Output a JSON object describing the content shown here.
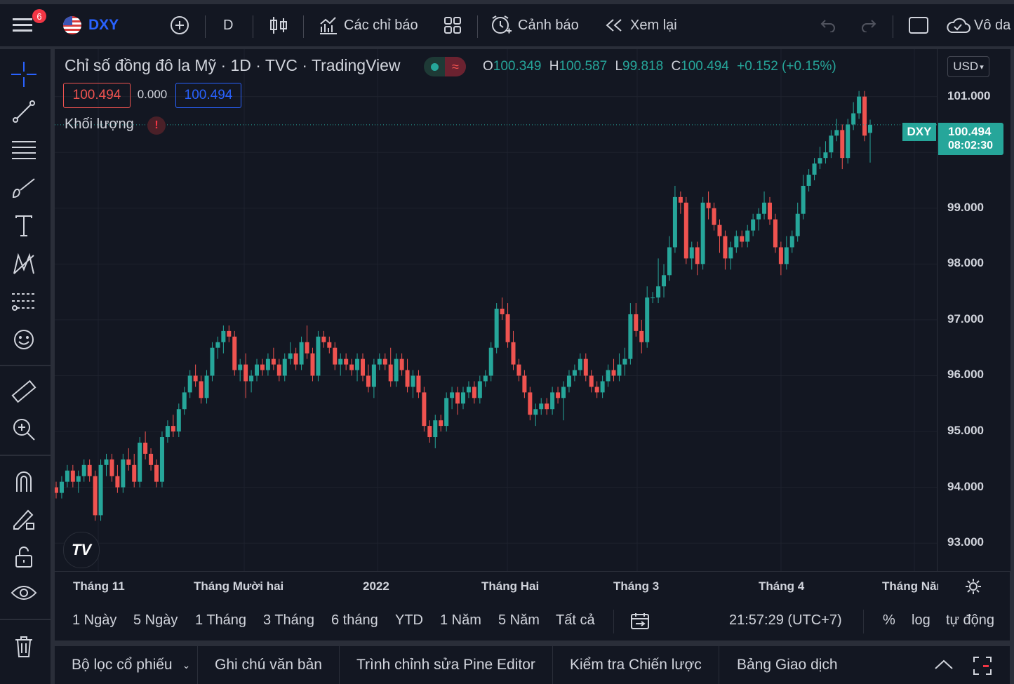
{
  "topbar": {
    "notification_count": "6",
    "symbol": "DXY",
    "interval": "D",
    "indicators_label": "Các chỉ báo",
    "alerts_label": "Cảnh báo",
    "replay_label": "Xem lại",
    "right_label": "Vô da"
  },
  "legend": {
    "title": "Chỉ số đồng đô la Mỹ · 1D · TVC · TradingView",
    "o_label": "O",
    "o_value": "100.349",
    "h_label": "H",
    "h_value": "100.587",
    "l_label": "L",
    "l_value": "99.818",
    "c_label": "C",
    "c_value": "100.494",
    "change": "+0.152 (+0.15%)",
    "bid": "100.494",
    "spread": "0.000",
    "ask": "100.494",
    "volume_label": "Khối lượng",
    "currency": "USD"
  },
  "price_label": {
    "symbol": "DXY",
    "price": "100.494",
    "countdown": "08:02:30"
  },
  "colors": {
    "up": "#26a69a",
    "down": "#ef5350",
    "background": "#131722",
    "accent": "#2962ff"
  },
  "chart_data": {
    "type": "candlestick",
    "y_ticks": [
      "101.000",
      "100.000",
      "99.000",
      "98.000",
      "97.000",
      "96.000",
      "95.000",
      "94.000",
      "93.000"
    ],
    "x_ticks": [
      "Tháng 11",
      "Tháng Mười hai",
      "2022",
      "Tháng Hai",
      "Tháng 3",
      "Tháng 4",
      "Tháng Năm"
    ],
    "ylim": [
      92.5,
      101.85
    ],
    "last_price": 100.494,
    "candles": [
      [
        94.0,
        94.1,
        93.8,
        93.9
      ],
      [
        93.9,
        94.2,
        93.8,
        94.1
      ],
      [
        94.1,
        94.4,
        94.0,
        94.3
      ],
      [
        94.3,
        94.4,
        94.0,
        94.1
      ],
      [
        94.1,
        94.3,
        93.9,
        94.2
      ],
      [
        94.2,
        94.5,
        94.1,
        94.4
      ],
      [
        94.4,
        94.5,
        94.1,
        94.2
      ],
      [
        94.2,
        94.3,
        93.4,
        93.5
      ],
      [
        93.5,
        94.5,
        93.4,
        94.4
      ],
      [
        94.4,
        94.6,
        94.2,
        94.5
      ],
      [
        94.5,
        94.6,
        94.1,
        94.2
      ],
      [
        94.2,
        94.4,
        93.9,
        94.0
      ],
      [
        94.0,
        94.6,
        93.9,
        94.5
      ],
      [
        94.5,
        94.7,
        94.3,
        94.4
      ],
      [
        94.4,
        94.6,
        94.0,
        94.1
      ],
      [
        94.1,
        94.9,
        94.0,
        94.8
      ],
      [
        94.8,
        95.0,
        94.5,
        94.6
      ],
      [
        94.6,
        94.7,
        94.3,
        94.4
      ],
      [
        94.4,
        94.5,
        94.0,
        94.1
      ],
      [
        94.1,
        95.0,
        94.0,
        94.9
      ],
      [
        94.9,
        95.2,
        94.8,
        95.1
      ],
      [
        95.1,
        95.3,
        94.9,
        95.0
      ],
      [
        95.0,
        95.5,
        94.9,
        95.4
      ],
      [
        95.4,
        95.8,
        95.3,
        95.7
      ],
      [
        95.7,
        96.1,
        95.6,
        96.0
      ],
      [
        96.0,
        96.2,
        95.8,
        95.9
      ],
      [
        95.9,
        96.0,
        95.5,
        95.6
      ],
      [
        95.6,
        96.1,
        95.5,
        96.0
      ],
      [
        96.0,
        96.6,
        95.9,
        96.5
      ],
      [
        96.5,
        96.7,
        96.3,
        96.6
      ],
      [
        96.6,
        96.9,
        96.4,
        96.8
      ],
      [
        96.8,
        96.9,
        96.6,
        96.7
      ],
      [
        96.7,
        96.8,
        96.0,
        96.1
      ],
      [
        96.1,
        96.3,
        95.9,
        96.2
      ],
      [
        96.2,
        96.4,
        95.6,
        95.9
      ],
      [
        95.9,
        96.1,
        95.7,
        96.0
      ],
      [
        96.0,
        96.3,
        95.9,
        96.2
      ],
      [
        96.2,
        96.3,
        96.0,
        96.1
      ],
      [
        96.1,
        96.4,
        96.0,
        96.3
      ],
      [
        96.3,
        96.5,
        96.1,
        96.2
      ],
      [
        96.2,
        96.3,
        95.9,
        96.0
      ],
      [
        96.0,
        96.4,
        95.9,
        96.3
      ],
      [
        96.3,
        96.6,
        96.2,
        96.4
      ],
      [
        96.4,
        96.5,
        96.1,
        96.2
      ],
      [
        96.2,
        96.7,
        96.1,
        96.6
      ],
      [
        96.6,
        96.9,
        96.3,
        96.4
      ],
      [
        96.4,
        96.5,
        95.9,
        96.0
      ],
      [
        96.0,
        96.8,
        95.9,
        96.7
      ],
      [
        96.7,
        96.8,
        96.5,
        96.6
      ],
      [
        96.6,
        96.7,
        96.4,
        96.5
      ],
      [
        96.5,
        96.6,
        96.1,
        96.2
      ],
      [
        96.2,
        96.4,
        96.0,
        96.3
      ],
      [
        96.3,
        96.4,
        96.1,
        96.2
      ],
      [
        96.2,
        96.3,
        96.0,
        96.1
      ],
      [
        96.1,
        96.4,
        95.9,
        96.3
      ],
      [
        96.3,
        96.4,
        95.9,
        96.0
      ],
      [
        96.0,
        96.2,
        95.7,
        95.8
      ],
      [
        95.8,
        96.3,
        95.6,
        96.2
      ],
      [
        96.2,
        96.4,
        96.1,
        96.3
      ],
      [
        96.3,
        96.4,
        96.1,
        96.2
      ],
      [
        96.2,
        96.5,
        95.8,
        95.9
      ],
      [
        95.9,
        96.4,
        95.8,
        96.3
      ],
      [
        96.3,
        96.4,
        96.0,
        96.1
      ],
      [
        96.1,
        96.3,
        95.7,
        95.8
      ],
      [
        95.8,
        96.1,
        95.6,
        96.0
      ],
      [
        96.0,
        96.1,
        95.6,
        95.7
      ],
      [
        95.7,
        95.8,
        95.0,
        95.1
      ],
      [
        95.1,
        95.2,
        94.8,
        94.9
      ],
      [
        94.9,
        95.3,
        94.7,
        95.2
      ],
      [
        95.2,
        95.3,
        95.0,
        95.1
      ],
      [
        95.1,
        95.7,
        95.0,
        95.6
      ],
      [
        95.6,
        95.8,
        95.4,
        95.7
      ],
      [
        95.7,
        95.8,
        95.3,
        95.5
      ],
      [
        95.5,
        95.8,
        95.4,
        95.7
      ],
      [
        95.7,
        95.9,
        95.6,
        95.8
      ],
      [
        95.8,
        95.9,
        95.5,
        95.6
      ],
      [
        95.6,
        96.0,
        95.5,
        95.9
      ],
      [
        95.9,
        96.1,
        95.8,
        96.0
      ],
      [
        96.0,
        96.6,
        95.9,
        96.5
      ],
      [
        96.5,
        97.3,
        96.4,
        97.2
      ],
      [
        97.2,
        97.4,
        97.0,
        97.1
      ],
      [
        97.1,
        97.3,
        96.5,
        96.6
      ],
      [
        96.6,
        96.8,
        96.1,
        96.2
      ],
      [
        96.2,
        96.3,
        95.9,
        96.0
      ],
      [
        96.0,
        96.1,
        95.6,
        95.7
      ],
      [
        95.7,
        95.8,
        95.2,
        95.3
      ],
      [
        95.3,
        95.5,
        95.1,
        95.4
      ],
      [
        95.4,
        95.6,
        95.3,
        95.5
      ],
      [
        95.5,
        95.6,
        95.3,
        95.4
      ],
      [
        95.4,
        95.8,
        95.3,
        95.7
      ],
      [
        95.7,
        95.8,
        95.5,
        95.6
      ],
      [
        95.6,
        95.9,
        95.2,
        95.8
      ],
      [
        95.8,
        96.1,
        95.7,
        96.0
      ],
      [
        96.0,
        96.2,
        95.9,
        96.1
      ],
      [
        96.1,
        96.4,
        96.0,
        96.3
      ],
      [
        96.3,
        96.4,
        95.9,
        96.0
      ],
      [
        96.0,
        96.1,
        95.7,
        95.8
      ],
      [
        95.8,
        95.9,
        95.6,
        95.7
      ],
      [
        95.7,
        96.0,
        95.6,
        95.9
      ],
      [
        95.9,
        96.2,
        95.8,
        96.1
      ],
      [
        96.1,
        96.3,
        95.9,
        96.0
      ],
      [
        96.0,
        96.4,
        95.9,
        96.2
      ],
      [
        96.2,
        96.5,
        96.0,
        96.3
      ],
      [
        96.3,
        97.3,
        96.2,
        97.1
      ],
      [
        97.1,
        97.3,
        96.7,
        96.8
      ],
      [
        96.8,
        97.0,
        96.4,
        96.6
      ],
      [
        96.6,
        97.6,
        96.5,
        97.4
      ],
      [
        97.4,
        97.5,
        97.3,
        97.4
      ],
      [
        97.4,
        98.1,
        97.3,
        97.6
      ],
      [
        97.6,
        98.0,
        97.4,
        97.8
      ],
      [
        97.8,
        98.5,
        97.7,
        98.3
      ],
      [
        98.3,
        99.4,
        98.2,
        99.2
      ],
      [
        99.2,
        99.3,
        98.9,
        99.1
      ],
      [
        99.1,
        99.2,
        98.0,
        98.1
      ],
      [
        98.1,
        98.4,
        97.9,
        98.3
      ],
      [
        98.3,
        98.4,
        97.8,
        98.0
      ],
      [
        98.0,
        99.2,
        97.9,
        99.1
      ],
      [
        99.1,
        99.3,
        98.8,
        99.0
      ],
      [
        99.0,
        99.1,
        98.6,
        98.7
      ],
      [
        98.7,
        98.8,
        98.2,
        98.5
      ],
      [
        98.5,
        98.6,
        97.9,
        98.1
      ],
      [
        98.1,
        98.4,
        97.9,
        98.3
      ],
      [
        98.3,
        98.6,
        98.2,
        98.5
      ],
      [
        98.5,
        98.6,
        98.3,
        98.4
      ],
      [
        98.4,
        98.7,
        98.3,
        98.6
      ],
      [
        98.6,
        98.9,
        98.5,
        98.8
      ],
      [
        98.8,
        99.0,
        98.6,
        98.9
      ],
      [
        98.9,
        99.3,
        98.8,
        99.1
      ],
      [
        99.1,
        99.2,
        98.7,
        98.8
      ],
      [
        98.8,
        98.9,
        98.2,
        98.3
      ],
      [
        98.3,
        98.4,
        97.8,
        98.0
      ],
      [
        98.0,
        98.5,
        97.9,
        98.3
      ],
      [
        98.3,
        98.6,
        98.2,
        98.5
      ],
      [
        98.5,
        99.1,
        98.4,
        98.9
      ],
      [
        98.9,
        99.6,
        98.8,
        99.4
      ],
      [
        99.4,
        99.7,
        99.3,
        99.6
      ],
      [
        99.6,
        99.9,
        99.5,
        99.8
      ],
      [
        99.8,
        100.1,
        99.7,
        99.9
      ],
      [
        99.9,
        100.2,
        99.8,
        100.0
      ],
      [
        100.0,
        100.4,
        99.9,
        100.3
      ],
      [
        100.3,
        100.6,
        100.2,
        100.4
      ],
      [
        100.4,
        100.5,
        99.7,
        99.9
      ],
      [
        99.9,
        100.6,
        99.8,
        100.5
      ],
      [
        100.5,
        100.9,
        100.4,
        100.7
      ],
      [
        100.7,
        101.1,
        100.6,
        101.0
      ],
      [
        101.0,
        101.1,
        100.2,
        100.3
      ],
      [
        100.349,
        100.587,
        99.818,
        100.494
      ]
    ]
  },
  "xaxis": {
    "ticks": [
      "Tháng 11",
      "Tháng Mười hai",
      "2022",
      "Tháng Hai",
      "Tháng 3",
      "Tháng 4",
      "Tháng Năm"
    ]
  },
  "range": {
    "items": [
      "1 Ngày",
      "5 Ngày",
      "1 Tháng",
      "3 Tháng",
      "6 tháng",
      "YTD",
      "1 Năm",
      "5 Năm",
      "Tất cả"
    ],
    "time": "21:57:29 (UTC+7)",
    "percent": "%",
    "log": "log",
    "auto": "tự động"
  },
  "bottom": {
    "screener": "Bộ lọc cổ phiếu",
    "notes": "Ghi chú văn bản",
    "pine": "Trình chỉnh sửa Pine Editor",
    "strategy": "Kiểm tra Chiến lược",
    "trading": "Bảng Giao dịch"
  }
}
